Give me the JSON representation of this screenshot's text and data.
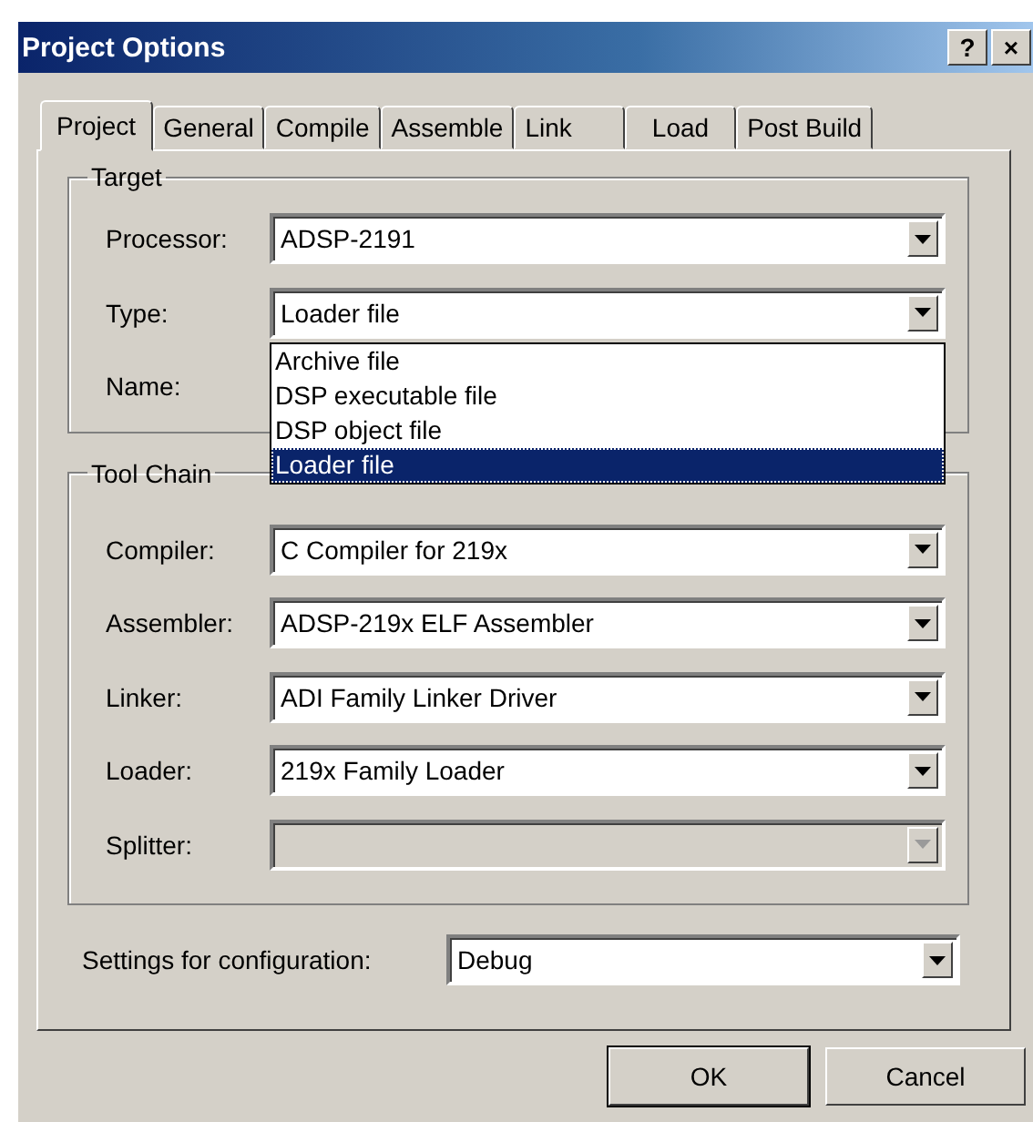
{
  "window": {
    "title": "Project Options",
    "buttons": [
      "?",
      "×"
    ]
  },
  "tabs": [
    {
      "label": "Project",
      "selected": true
    },
    {
      "label": "General",
      "selected": false
    },
    {
      "label": "Compile",
      "selected": false
    },
    {
      "label": "Assemble",
      "selected": false
    },
    {
      "label": "Link",
      "selected": false
    },
    {
      "label": "Load",
      "selected": false
    },
    {
      "label": "Post Build",
      "selected": false
    }
  ],
  "target": {
    "title": "Target",
    "fields": [
      {
        "label": "Processor:",
        "value": "ADSP-2191",
        "disabled": false
      },
      {
        "label": "Type:",
        "value": "Loader file",
        "disabled": false,
        "options": [
          {
            "label": "Archive file",
            "selected": false
          },
          {
            "label": "DSP executable file",
            "selected": false
          },
          {
            "label": "DSP object file",
            "selected": false
          },
          {
            "label": "Loader file",
            "selected": true
          }
        ]
      },
      {
        "label": "Name:"
      }
    ]
  },
  "tool_chain": {
    "title": "Tool Chain",
    "fields": [
      {
        "label": "Compiler:",
        "value": "C Compiler for 219x",
        "disabled": false
      },
      {
        "label": "Assembler:",
        "value": "ADSP-219x ELF Assembler",
        "disabled": false
      },
      {
        "label": "Linker:",
        "value": "ADI Family Linker Driver",
        "disabled": false
      },
      {
        "label": "Loader:",
        "value": "219x Family Loader",
        "disabled": false
      },
      {
        "label": "Splitter:",
        "disabled": true
      }
    ]
  },
  "configuration": {
    "label": "Settings for configuration:",
    "value": "Debug"
  },
  "buttons": [
    {
      "label": "OK",
      "default": true
    },
    {
      "label": "Cancel",
      "default": false
    }
  ]
}
